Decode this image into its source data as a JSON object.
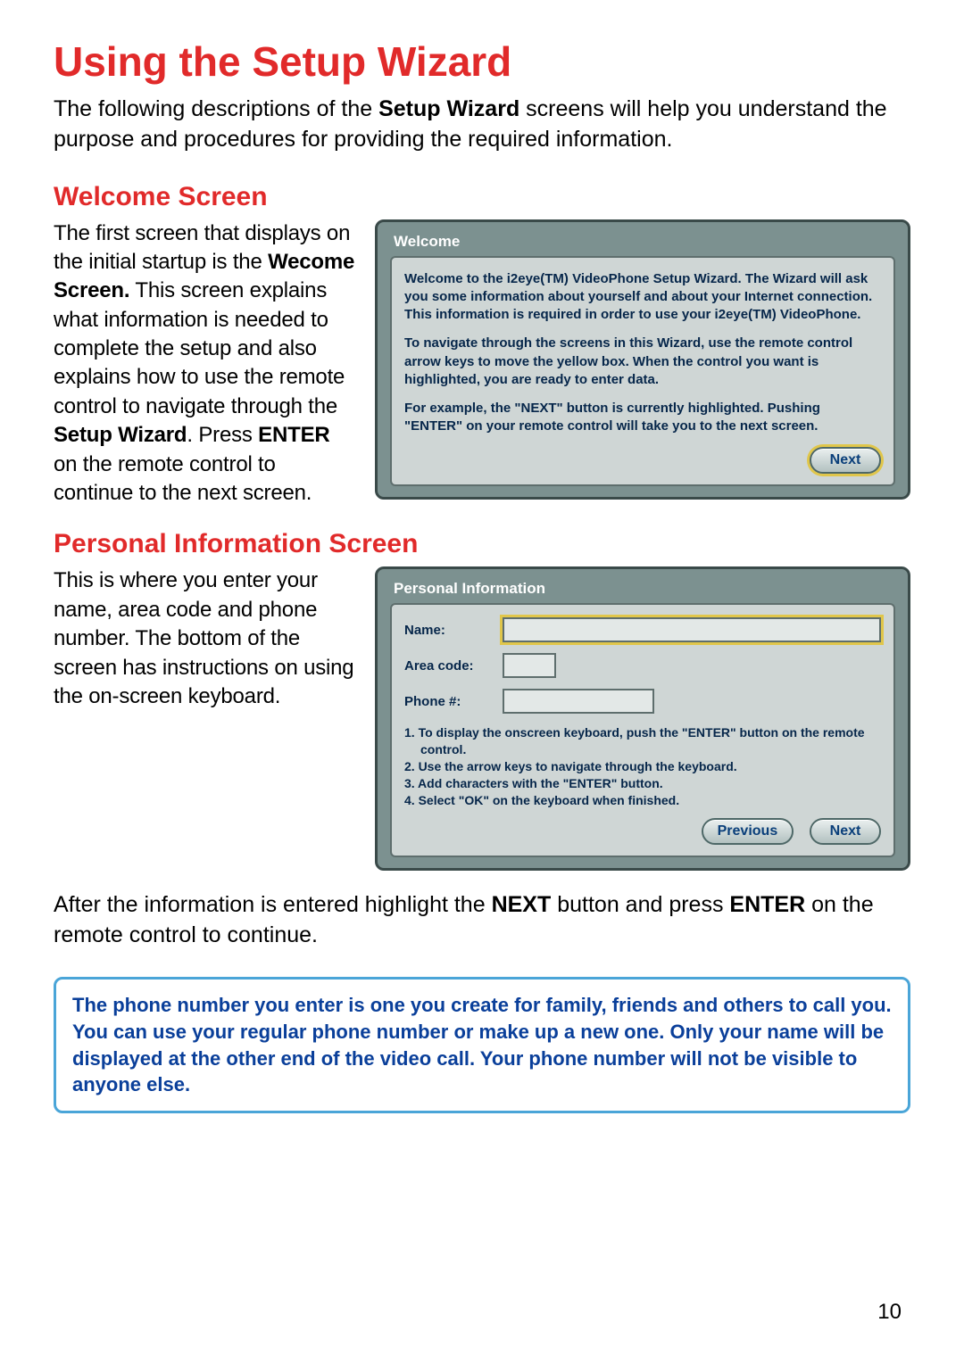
{
  "title": "Using the Setup Wizard",
  "intro_a": "The following descriptions of the ",
  "intro_b": "Setup Wizard",
  "intro_c": " screens will help you understand the purpose and procedures for providing the required information.",
  "welcome_heading": "Welcome  Screen",
  "welcome_text_1": "The first screen that displays on the initial startup is the ",
  "welcome_text_2": "Wecome Screen.",
  "welcome_text_3": "  This screen explains what information is needed to complete the setup and also explains how to use the remote control to navigate through the ",
  "welcome_text_4": "Setup Wizard",
  "welcome_text_5": ".  Press ",
  "welcome_text_6": "ENTER",
  "welcome_text_7": " on the remote control to continue to the next screen.",
  "welcome_shot": {
    "title": "Welcome",
    "p1": "Welcome to the i2eye(TM) VideoPhone Setup Wizard. The Wizard will ask you some information about yourself and about your Internet connection. This information is required in order to use your i2eye(TM) VideoPhone.",
    "p2": "To navigate through the screens in this Wizard, use the remote control arrow keys to move the yellow box. When the control you want is highlighted, you are ready to enter data.",
    "p3": "For example, the \"NEXT\" button is currently highlighted. Pushing \"ENTER\" on your remote control will take you to the next screen.",
    "next": "Next"
  },
  "personal_heading": "Personal  Information  Screen",
  "personal_text": "This is where you enter your name, area code and phone number.  The bottom of the screen has instructions on using the on-screen keyboard.",
  "personal_shot": {
    "title": "Personal Information",
    "labels": {
      "name": "Name:",
      "area": "Area code:",
      "phone": "Phone #:"
    },
    "instr": [
      "1. To display the onscreen keyboard, push the \"ENTER\" button on the remote control.",
      "2. Use the arrow keys to navigate through the keyboard.",
      "3. Add characters with the \"ENTER\" button.",
      "4. Select \"OK\" on the keyboard when finished."
    ],
    "prev": "Previous",
    "next": "Next"
  },
  "after_1": "After the information is entered highlight the ",
  "after_2": "NEXT",
  "after_3": " button and press ",
  "after_4": "ENTER",
  "after_5": " on the remote control to continue.",
  "callout": "The phone number you enter is one you create for family, friends and others to call you.  You can use your regular phone number or make up a new one.  Only your name will be displayed at the other end of the video call.  Your phone number will not be visible to anyone else.",
  "page_number": "10"
}
